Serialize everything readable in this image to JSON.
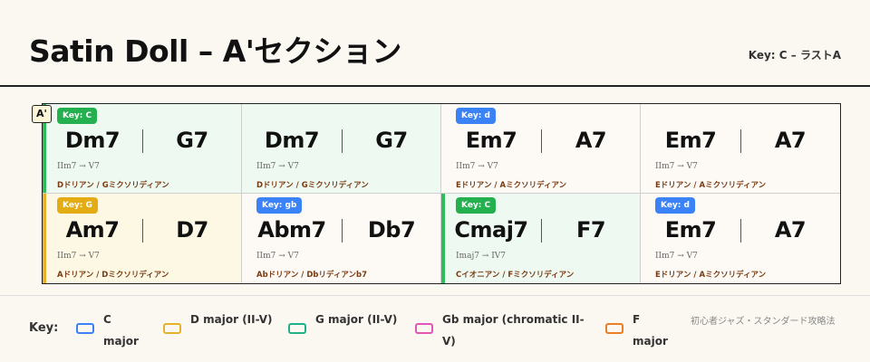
{
  "header": {
    "title": "Satin Doll – A'セクション",
    "key_info": "Key: C – ラストA"
  },
  "section_marker": "A'",
  "grid": {
    "cells": [
      {
        "badge": "Key: C",
        "badge_color": "#25b04f",
        "chord1": "Dm7",
        "chord2": "G7",
        "roman": "IIm7 → V7",
        "modes": "Dドリアン / Gミクソリディアン"
      },
      {
        "badge": "",
        "chord1": "Dm7",
        "chord2": "G7",
        "roman": "IIm7 → V7",
        "modes": "Dドリアン / Gミクソリディアン"
      },
      {
        "badge": "Key: d",
        "badge_color": "#3b82f6",
        "chord1": "Em7",
        "chord2": "A7",
        "roman": "IIm7 → V7",
        "modes": "Eドリアン / Aミクソリディアン"
      },
      {
        "badge": "",
        "chord1": "Em7",
        "chord2": "A7",
        "roman": "IIm7 → V7",
        "modes": "Eドリアン / Aミクソリディアン"
      },
      {
        "badge": "Key: G",
        "badge_color": "#e4ac13",
        "chord1": "Am7",
        "chord2": "D7",
        "roman": "IIm7 → V7",
        "modes": "Aドリアン / Dミクソリディアン"
      },
      {
        "badge": "Key: gb",
        "badge_color": "#3b82f6",
        "chord1": "Abm7",
        "chord2": "Db7",
        "roman": "IIm7 → V7",
        "modes": "Abドリアン / Dbリディアンb7"
      },
      {
        "badge": "Key: C",
        "badge_color": "#25b04f",
        "chord1": "Cmaj7",
        "chord2": "F7",
        "roman": "Imaj7 → IV7",
        "modes": "Cイオニアン / Fミクソリディアン"
      },
      {
        "badge": "Key: d",
        "badge_color": "#3b82f6",
        "chord1": "Em7",
        "chord2": "A7",
        "roman": "IIm7 → V7",
        "modes": "Eドリアン / Aミクソリディアン"
      }
    ]
  },
  "legend": {
    "title": "Key:",
    "items": [
      {
        "label": "C major",
        "color": "#3b82f6"
      },
      {
        "label": "D major (II-V)",
        "color": "#e7b12c"
      },
      {
        "label": "G major (II-V)",
        "color": "#22b08a"
      },
      {
        "label": "Gb major (chromatic II-V)",
        "color": "#e055b5"
      },
      {
        "label": "F major",
        "color": "#ef7d22"
      }
    ],
    "source": "初心者ジャズ・スタンダード攻略法"
  }
}
